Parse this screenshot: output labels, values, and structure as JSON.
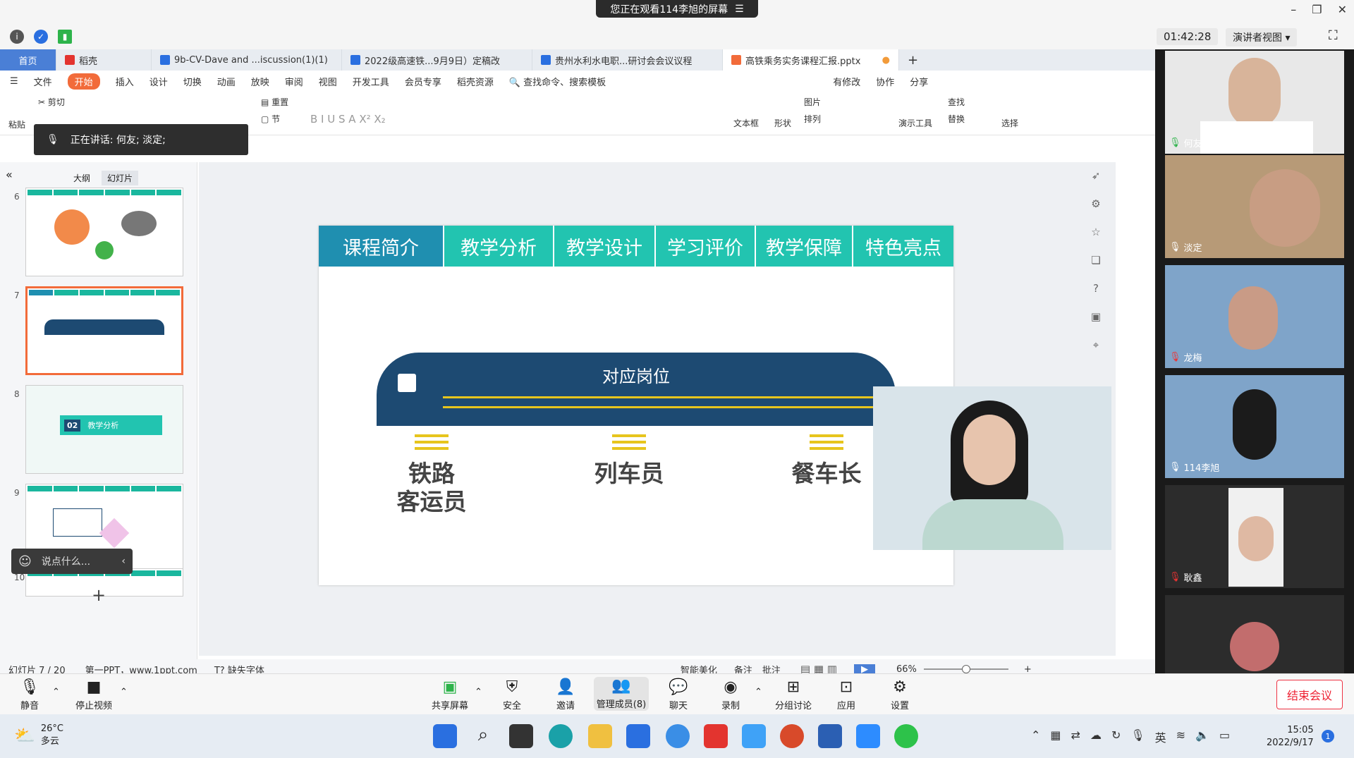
{
  "meeting": {
    "share_banner": "您正在观看114李旭的屏幕",
    "timer": "01:42:28",
    "presenter_view": "演讲者视图",
    "speaking": "正在讲话: 何友; 淡定;",
    "chat_placeholder": "说点什么...",
    "participants": [
      {
        "name": "何友"
      },
      {
        "name": "淡定"
      },
      {
        "name": "龙梅"
      },
      {
        "name": "114李旭"
      },
      {
        "name": "耿鑫"
      }
    ]
  },
  "wps": {
    "tabs": [
      {
        "label": "首页"
      },
      {
        "label": "稻壳"
      },
      {
        "label": "9b-CV-Dave and ...iscussion(1)(1)"
      },
      {
        "label": "2022级高速铁...9月9日）定稿改"
      },
      {
        "label": "贵州水利水电职...研讨会会议议程"
      },
      {
        "label": "高铁乘务实务课程汇报.pptx"
      }
    ],
    "menu": [
      "文件",
      "开始",
      "插入",
      "设计",
      "切换",
      "动画",
      "放映",
      "审阅",
      "视图",
      "开发工具",
      "会员专享",
      "稻壳资源"
    ],
    "search_placeholder": "查找命令、搜索模板",
    "menu_right": [
      "有修改",
      "协作",
      "分享"
    ],
    "toolbar": [
      "粘贴",
      "剪切",
      "重置",
      "节",
      "文本框",
      "形状",
      "图片",
      "排列",
      "演示工具",
      "查找",
      "替换",
      "选择"
    ],
    "panel_tabs": [
      "大纲",
      "幻灯片"
    ],
    "slide_numbers": [
      "6",
      "7",
      "8",
      "9",
      "10"
    ],
    "thumb8_text": "02",
    "thumb8_label": "教学分析",
    "status": {
      "slide_count": "幻灯片 7 / 20",
      "theme": "第一PPT，www.1ppt.com",
      "missing_font": "缺失字体",
      "beautify": "智能美化",
      "notes": "备注",
      "comment": "批注",
      "zoom": "66%"
    }
  },
  "slide": {
    "nav": [
      "课程简介",
      "教学分析",
      "教学设计",
      "学习评价",
      "教学保障",
      "特色亮点"
    ],
    "banner_title": "对应岗位",
    "roles": [
      "铁路\n客运员",
      "列车员",
      "餐车长"
    ]
  },
  "zoom_bar": [
    {
      "label": "静音"
    },
    {
      "label": "停止视频"
    },
    {
      "label": "共享屏幕"
    },
    {
      "label": "安全"
    },
    {
      "label": "邀请"
    },
    {
      "label": "管理成员(8)"
    },
    {
      "label": "聊天"
    },
    {
      "label": "录制"
    },
    {
      "label": "分组讨论"
    },
    {
      "label": "应用"
    },
    {
      "label": "设置"
    }
  ],
  "end_meeting": "结束会议",
  "taskbar": {
    "temperature": "26°C",
    "weather": "多云",
    "time": "15:05",
    "date": "2022/9/17",
    "ime": "英",
    "notif": "1"
  },
  "colors": {
    "teal": "#22c4b0",
    "nav_active": "#1f8fb0",
    "banner": "#1d4a72",
    "gold": "#e7c51d",
    "wps_orange": "#f26b3a"
  }
}
